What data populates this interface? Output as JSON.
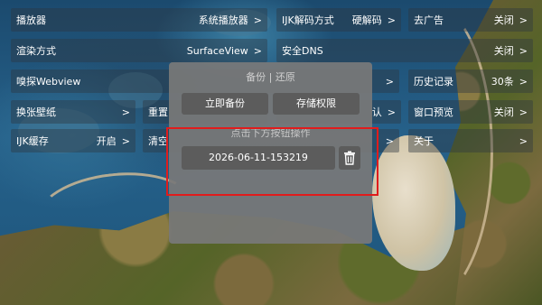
{
  "settings": {
    "row1": {
      "player": {
        "label": "播放器",
        "value": "系统播放器",
        "arrow": ">"
      },
      "decode": {
        "label": "IJK解码方式",
        "value": "硬解码",
        "arrow": ">"
      },
      "ads": {
        "label": "去广告",
        "value": "关闭",
        "arrow": ">"
      }
    },
    "row2": {
      "render": {
        "label": "渲染方式",
        "value": "SurfaceView",
        "arrow": ">"
      },
      "dns": {
        "label": "安全DNS"
      },
      "dns_right": {
        "value": "关闭",
        "arrow": ">"
      }
    },
    "row3": {
      "sniff": {
        "label": "嗅探Webview"
      },
      "sniff_right": {
        "arrow": ">"
      },
      "history": {
        "label": "历史记录",
        "value": "30条",
        "arrow": ">"
      }
    },
    "row4": {
      "wallpaper": {
        "label": "换张壁纸",
        "arrow": ">"
      },
      "reset": {
        "label": "重置"
      },
      "partial": {
        "label": "认",
        "arrow": ">"
      },
      "preview": {
        "label": "窗口预览",
        "value": "关闭",
        "arrow": ">"
      }
    },
    "row5": {
      "ijkcache": {
        "label": "IJK缓存",
        "value": "开启",
        "arrow": ">"
      },
      "clear": {
        "label": "清空"
      },
      "clear_right": {
        "arrow": ">"
      },
      "about": {
        "label": "关于",
        "arrow": ">"
      }
    }
  },
  "dialog": {
    "title": "备份 | 还原",
    "backup_now": "立即备份",
    "storage_permission": "存储权限",
    "hint": "点击下方按钮操作",
    "backup_file": "2026-06-11-153219",
    "delete_icon": "trash-icon"
  },
  "colors": {
    "highlight": "#e01c1c",
    "dialog_bg": "#787878",
    "button_bg": "#5c5c5c"
  }
}
